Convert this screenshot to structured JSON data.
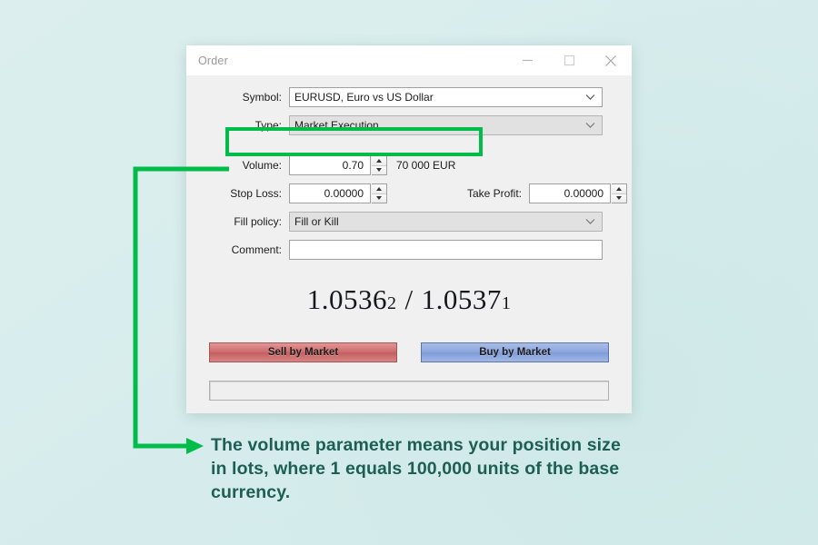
{
  "theme": {
    "page_background": "#d8eeed",
    "accent_green": "#00bd4a",
    "annotation_text_color": "#1d5f55",
    "sell_button_color": "#cc6b6b",
    "buy_button_color": "#8ca6dd",
    "dialog_background": "#f0f0f0"
  },
  "window": {
    "title": "Order",
    "controls": {
      "minimize": "minimize-icon",
      "maximize": "maximize-icon",
      "close": "close-icon"
    }
  },
  "form": {
    "symbol": {
      "label": "Symbol:",
      "value": "EURUSD, Euro vs US Dollar",
      "enabled": true
    },
    "type": {
      "label": "Type:",
      "value": "Market Execution",
      "enabled": false
    },
    "volume": {
      "label": "Volume:",
      "value": "0.70",
      "suffix": "70 000 EUR",
      "highlighted": true
    },
    "stop_loss": {
      "label": "Stop Loss:",
      "value": "0.00000"
    },
    "take_profit": {
      "label": "Take Profit:",
      "value": "0.00000"
    },
    "fill_policy": {
      "label": "Fill policy:",
      "value": "Fill or Kill",
      "enabled": false
    },
    "comment": {
      "label": "Comment:",
      "value": "",
      "placeholder": ""
    }
  },
  "quote": {
    "bid_main": "1.0536",
    "bid_pip": "2",
    "separator": "/",
    "ask_main": "1.0537",
    "ask_pip": "1"
  },
  "actions": {
    "sell_label": "Sell by Market",
    "buy_label": "Buy by Market"
  },
  "status_bar": {
    "text": ""
  },
  "annotation": {
    "line1_a": "The volume parameter means your position size",
    "line2_a": "in lots, where ",
    "line2_b": "1",
    "line2_c": " equals ",
    "line2_d": "100,000",
    "line2_e": " units of the base",
    "line3_a": "currency."
  }
}
